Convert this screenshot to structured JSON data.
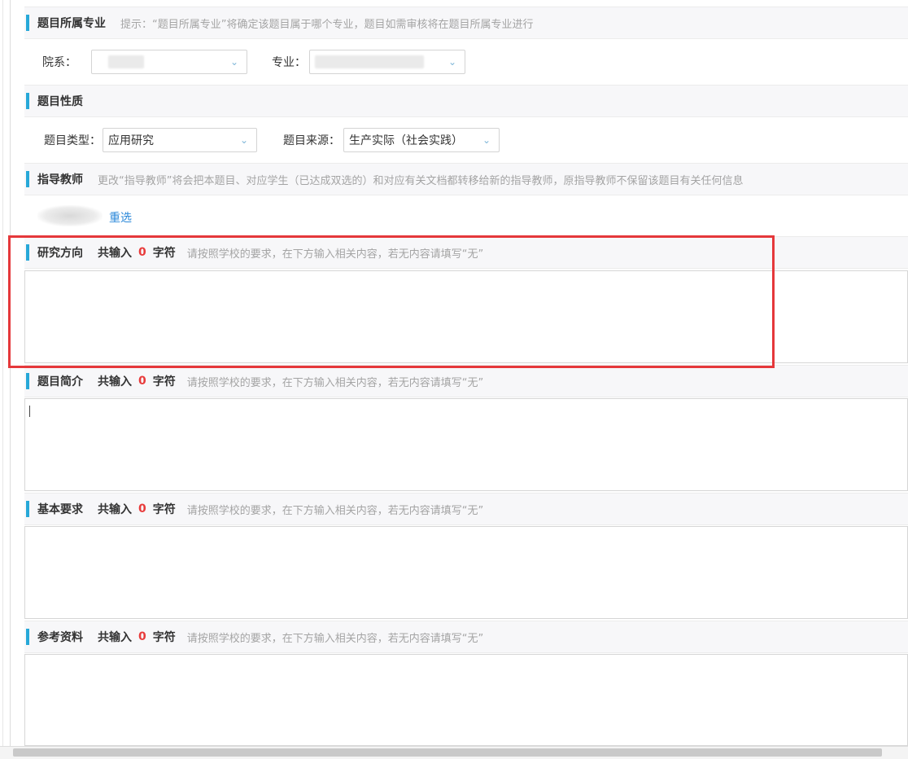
{
  "sections": {
    "major": {
      "title": "题目所属专业",
      "hint": "提示：“题目所属专业”将确定该题目属于哪个专业，题目如需审核将在题目所属专业进行",
      "department_label": "院系：",
      "major_label": "专业："
    },
    "nature": {
      "title": "题目性质",
      "type_label": "题目类型：",
      "type_value": "应用研究",
      "source_label": "题目来源：",
      "source_value": "生产实际（社会实践）"
    },
    "advisor": {
      "title": "指导教师",
      "hint": "更改“指导教师”将会把本题目、对应学生（已达成双选的）和对应有关文档都转移给新的指导教师，原指导教师不保留该题目有关任何信息",
      "reselect": "重选"
    },
    "research": {
      "title": "研究方向",
      "count_prefix": "共输入",
      "count": "0",
      "count_suffix": "字符",
      "hint": "请按照学校的要求，在下方输入相关内容，若无内容请填写“无”",
      "value": ""
    },
    "intro": {
      "title": "题目简介",
      "count_prefix": "共输入",
      "count": "0",
      "count_suffix": "字符",
      "hint": "请按照学校的要求，在下方输入相关内容，若无内容请填写“无”",
      "value": ""
    },
    "requirements": {
      "title": "基本要求",
      "count_prefix": "共输入",
      "count": "0",
      "count_suffix": "字符",
      "hint": "请按照学校的要求，在下方输入相关内容，若无内容请填写“无”",
      "value": ""
    },
    "references": {
      "title": "参考资料",
      "count_prefix": "共输入",
      "count": "0",
      "count_suffix": "字符",
      "hint": "请按照学校的要求，在下方输入相关内容，若无内容请填写“无”",
      "value": ""
    }
  },
  "colors": {
    "accent_bar": "#27a8d8",
    "count_number": "#e83b3b",
    "link": "#2b88d9",
    "highlight_box": "#e5383b"
  },
  "icons": {
    "dropdown": "chevron-down-icon"
  }
}
